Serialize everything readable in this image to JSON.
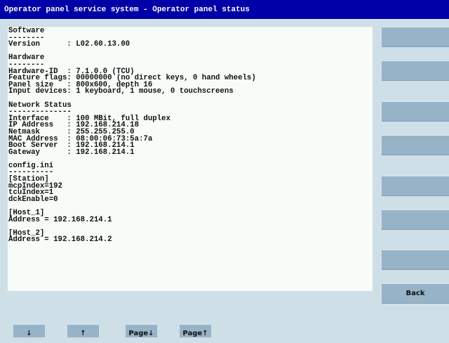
{
  "title": "Operator panel service system - Operator panel status",
  "content_lines": [
    "Software",
    "--------",
    "Version      : L02.60.13.00",
    "",
    "Hardware",
    "--------",
    "Hardware-ID  : 7.1.0.0 (TCU)",
    "Feature flags: 00000000 (no direct keys, 0 hand wheels)",
    "Panel size   : 800x600, depth 16",
    "Input devices: 1 keyboard, 1 mouse, 0 touchscreens",
    "",
    "Network Status",
    "--------------",
    "Interface    : 100 MBit, full duplex",
    "IP Address   : 192.168.214.18",
    "Netmask      : 255.255.255.0",
    "MAC Address  : 08:00:06:73:5a:7a",
    "Boot Server  : 192.168.214.1",
    "Gateway      : 192.168.214.1",
    "",
    "config.ini",
    "----------",
    "[Station]",
    "mcpIndex=192",
    "tcuIndex=1",
    "dckEnable=0",
    "",
    "[Host_1]",
    "Address = 192.168.214.1",
    "",
    "[Host_2]",
    "Address = 192.168.214.2"
  ],
  "softkeys": [
    "",
    "",
    "",
    "",
    "",
    "",
    "",
    "Back"
  ],
  "bottom_keys": [
    "↓",
    "↑",
    "Page↓",
    "Page↑"
  ]
}
